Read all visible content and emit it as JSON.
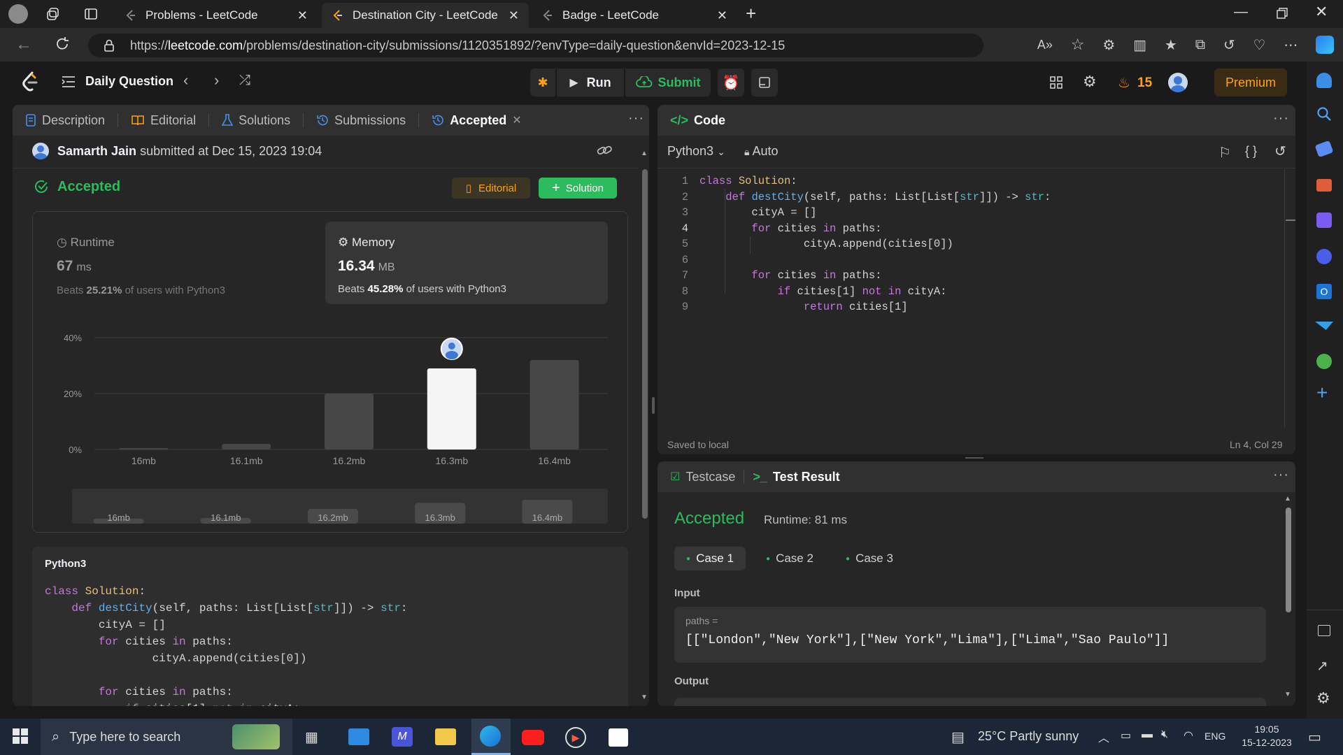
{
  "browser": {
    "tabs": [
      {
        "title": "Problems - LeetCode",
        "active": false
      },
      {
        "title": "Destination City - LeetCode",
        "active": true
      },
      {
        "title": "Badge - LeetCode",
        "active": false
      }
    ],
    "url_prefix": "https://",
    "url_host": "leetcode.com",
    "url_path": "/problems/destination-city/submissions/1120351892/?envType=daily-question&envId=2023-12-15"
  },
  "nav": {
    "title": "Daily Question",
    "run_label": "Run",
    "submit_label": "Submit",
    "streak": "15",
    "premium_label": "Premium"
  },
  "left_panel": {
    "tabs": {
      "description": "Description",
      "editorial": "Editorial",
      "solutions": "Solutions",
      "submissions": "Submissions",
      "accepted": "Accepted"
    },
    "submitter": "Samarth Jain",
    "submitted_text": "submitted at Dec 15, 2023 19:04",
    "status": "Accepted",
    "editorial_btn": "Editorial",
    "solution_btn": "Solution",
    "runtime": {
      "label": "Runtime",
      "value": "67",
      "unit": "ms",
      "beats_prefix": "Beats",
      "beats": "25.21%",
      "beats_suffix": "of users with Python3"
    },
    "memory": {
      "label": "Memory",
      "value": "16.34",
      "unit": "MB",
      "beats_prefix": "Beats",
      "beats": "45.28%",
      "beats_suffix": "of users with Python3"
    },
    "code_lang": "Python3"
  },
  "chart_data": {
    "type": "bar",
    "categories": [
      "16mb",
      "16.1mb",
      "16.2mb",
      "16.3mb",
      "16.4mb"
    ],
    "values": [
      0.5,
      2,
      20,
      29,
      32
    ],
    "highlight": "16.3mb",
    "yticks": [
      "40%",
      "20%",
      "0%"
    ],
    "ylim": [
      0,
      40
    ],
    "overview_values": [
      1,
      2,
      14,
      22,
      26
    ]
  },
  "code": {
    "header": "Code",
    "language": "Python3",
    "mode": "Auto",
    "saved": "Saved to local",
    "cursor": "Ln 4, Col 29"
  },
  "testresult": {
    "tab_testcase": "Testcase",
    "tab_result": "Test Result",
    "status": "Accepted",
    "runtime": "Runtime: 81 ms",
    "cases": [
      "Case 1",
      "Case 2",
      "Case 3"
    ],
    "input_label": "Input",
    "param_name": "paths =",
    "param_value": "[[\"London\",\"New York\"],[\"New York\",\"Lima\"],[\"Lima\",\"Sao Paulo\"]]",
    "output_label": "Output"
  },
  "taskbar": {
    "search_placeholder": "Type here to search",
    "weather": "25°C  Partly sunny",
    "lang": "ENG",
    "time": "19:05",
    "date": "15-12-2023"
  }
}
